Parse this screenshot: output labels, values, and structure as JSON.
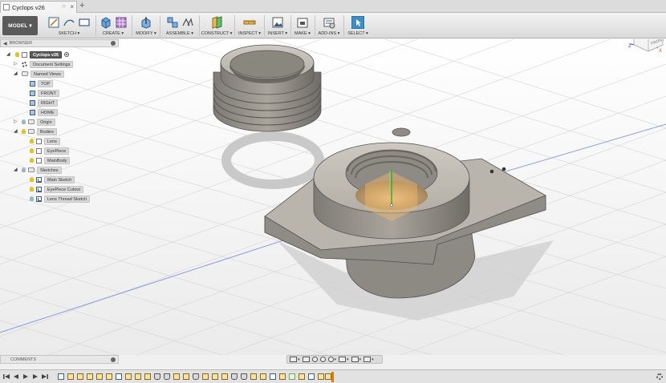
{
  "app": {
    "tab_title": "Cyclops v26",
    "tab_add": "+"
  },
  "toolbar": {
    "workspace": "MODEL ▾",
    "groups": [
      {
        "label": "SKETCH ▾"
      },
      {
        "label": "CREATE ▾"
      },
      {
        "label": "MODIFY ▾"
      },
      {
        "label": "ASSEMBLE ▾"
      },
      {
        "label": "CONSTRUCT ▾"
      },
      {
        "label": "INSPECT ▾"
      },
      {
        "label": "INSERT ▾"
      },
      {
        "label": "MAKE ▾"
      },
      {
        "label": "ADD-INS ▾"
      },
      {
        "label": "SELECT ▾"
      }
    ]
  },
  "browser": {
    "header": "BROWSER",
    "root": "Cyclops v26",
    "document_settings": "Document Settings",
    "named_views": "Named Views",
    "views": [
      "TOP",
      "FRONT",
      "RIGHT",
      "HOME"
    ],
    "origin": "Origin",
    "bodies": "Bodies",
    "body_items": [
      "Lens",
      "EyePiece",
      "MainBody"
    ],
    "sketches": "Sketches",
    "sketch_items": [
      "Main Sketch",
      "EyePiece Cutout",
      "Lens Thread Sketch"
    ]
  },
  "viewcube": {
    "face": "FRONT",
    "axis_z": "Z",
    "axis_x": "X"
  },
  "comments": {
    "header": "COMMENTS"
  },
  "colors": {
    "model_button": "#5a5a5a",
    "select_accent": "#3e8ec4",
    "timeline_marker": "#e07b00",
    "model_surface": "#b9b5ac"
  }
}
